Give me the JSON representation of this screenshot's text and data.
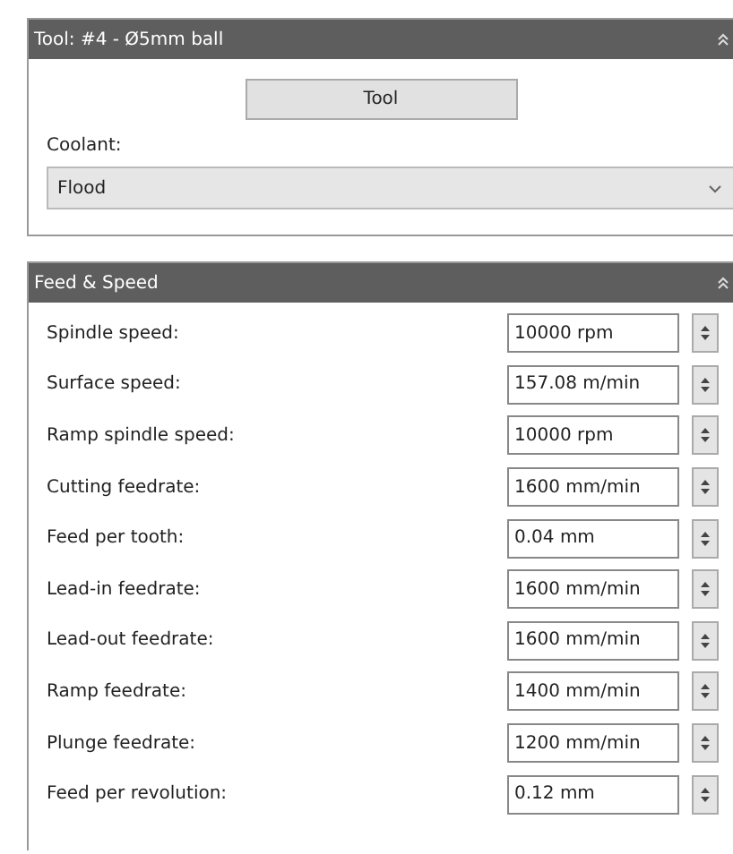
{
  "tool_panel": {
    "title": "Tool:  #4 - Ø5mm ball",
    "button": "Tool",
    "coolant_label": "Coolant:",
    "coolant_value": "Flood"
  },
  "feed_panel": {
    "title": "Feed & Speed",
    "rows": [
      {
        "label": "Spindle speed:",
        "value": "10000 rpm"
      },
      {
        "label": "Surface speed:",
        "value": "157.08 m/min"
      },
      {
        "label": "Ramp spindle speed:",
        "value": "10000 rpm"
      },
      {
        "label": "Cutting feedrate:",
        "value": "1600 mm/min"
      },
      {
        "label": "Feed per tooth:",
        "value": "0.04 mm"
      },
      {
        "label": "Lead-in feedrate:",
        "value": "1600 mm/min"
      },
      {
        "label": "Lead-out feedrate:",
        "value": "1600 mm/min"
      },
      {
        "label": "Ramp feedrate:",
        "value": "1400 mm/min"
      },
      {
        "label": "Plunge feedrate:",
        "value": "1200 mm/min"
      },
      {
        "label": "Feed per revolution:",
        "value": "0.12 mm"
      }
    ]
  }
}
